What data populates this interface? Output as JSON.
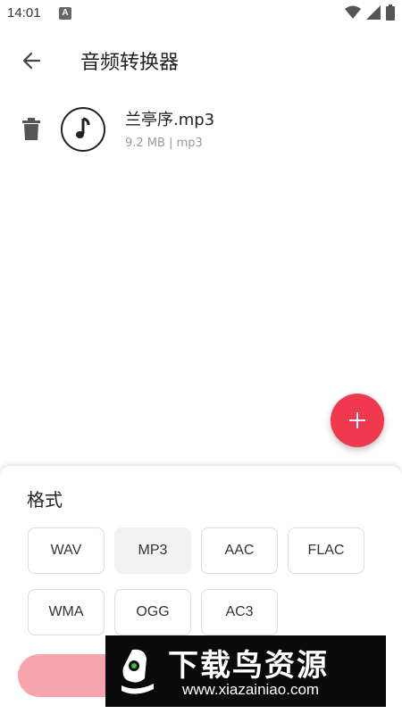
{
  "status_bar": {
    "time": "14:01",
    "notification_letter": "A"
  },
  "app_bar": {
    "title": "音频转换器"
  },
  "files": [
    {
      "name": "兰亭序.mp3",
      "meta": "9.2 MB | mp3",
      "icon": "music-note-icon"
    }
  ],
  "sheet": {
    "title": "格式",
    "formats": [
      "WAV",
      "MP3",
      "AAC",
      "FLAC",
      "WMA",
      "OGG",
      "AC3"
    ],
    "selected_format": "MP3"
  },
  "watermark": {
    "title": "下载鸟资源",
    "url": "www.xiazainiao.com"
  },
  "colors": {
    "accent": "#f0384f",
    "convert_button": "#f8a4ae",
    "selected_chip": "#f2f2f2"
  }
}
